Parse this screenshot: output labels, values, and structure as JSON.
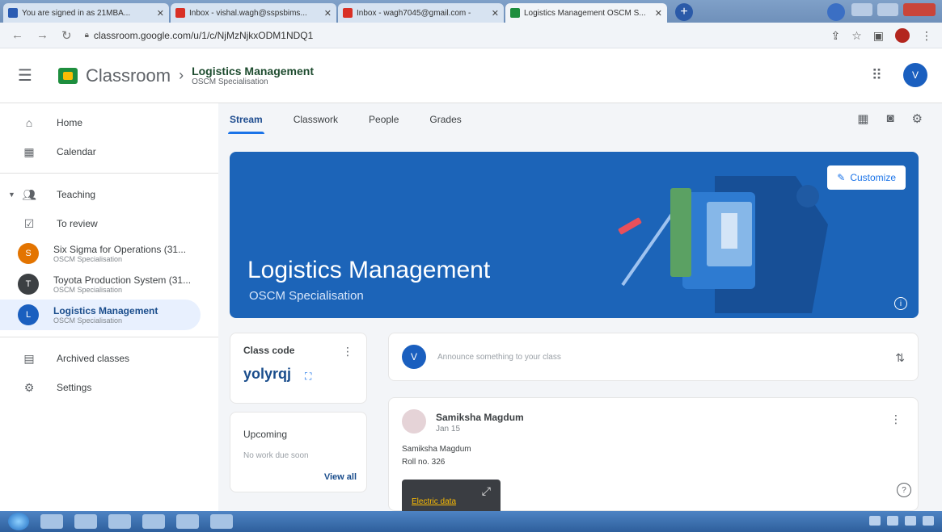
{
  "browser": {
    "tabs": [
      {
        "title": "You are signed in as 21MBA...",
        "color": "#2a5cb3"
      },
      {
        "title": "Inbox - vishal.wagh@sspsbims...",
        "color": "#d93025"
      },
      {
        "title": "Inbox - wagh7045@gmail.com -",
        "color": "#d93025"
      },
      {
        "title": "Logistics Management OSCM S...",
        "color": "#1e8e3e"
      }
    ],
    "new_tab": "+",
    "url": "classroom.google.com/u/1/c/NjMzNjkxODM1NDQ1"
  },
  "header": {
    "brand": "Classroom",
    "breadcrumb_title": "Logistics Management",
    "breadcrumb_subtitle": "OSCM Specialisation",
    "user_initial": "V"
  },
  "sidebar": {
    "home": "Home",
    "calendar": "Calendar",
    "teaching": "Teaching",
    "to_review": "To review",
    "classes": [
      {
        "initial": "S",
        "name": "Six Sigma for Operations (31...",
        "section": "OSCM Specialisation",
        "color": "#e37400"
      },
      {
        "initial": "T",
        "name": "Toyota Production System (31...",
        "section": "OSCM Specialisation",
        "color": "#3c4043"
      },
      {
        "initial": "L",
        "name": "Logistics Management",
        "section": "OSCM Specialisation",
        "color": "#1a5fbf"
      }
    ],
    "archived": "Archived classes",
    "settings": "Settings"
  },
  "tabs": [
    "Stream",
    "Classwork",
    "People",
    "Grades"
  ],
  "banner": {
    "title": "Logistics Management",
    "subtitle": "OSCM Specialisation",
    "customize": "Customize"
  },
  "class_code": {
    "label": "Class code",
    "code": "yolyrqj"
  },
  "upcoming": {
    "label": "Upcoming",
    "none": "No work due soon",
    "view_all": "View all"
  },
  "announce": {
    "initial": "V",
    "placeholder": "Announce something to your class"
  },
  "post": {
    "author": "Samiksha Magdum",
    "date": "Jan 15",
    "line1": "Samiksha Magdum",
    "line2": "Roll no. 326",
    "attachment": "Electric data"
  }
}
